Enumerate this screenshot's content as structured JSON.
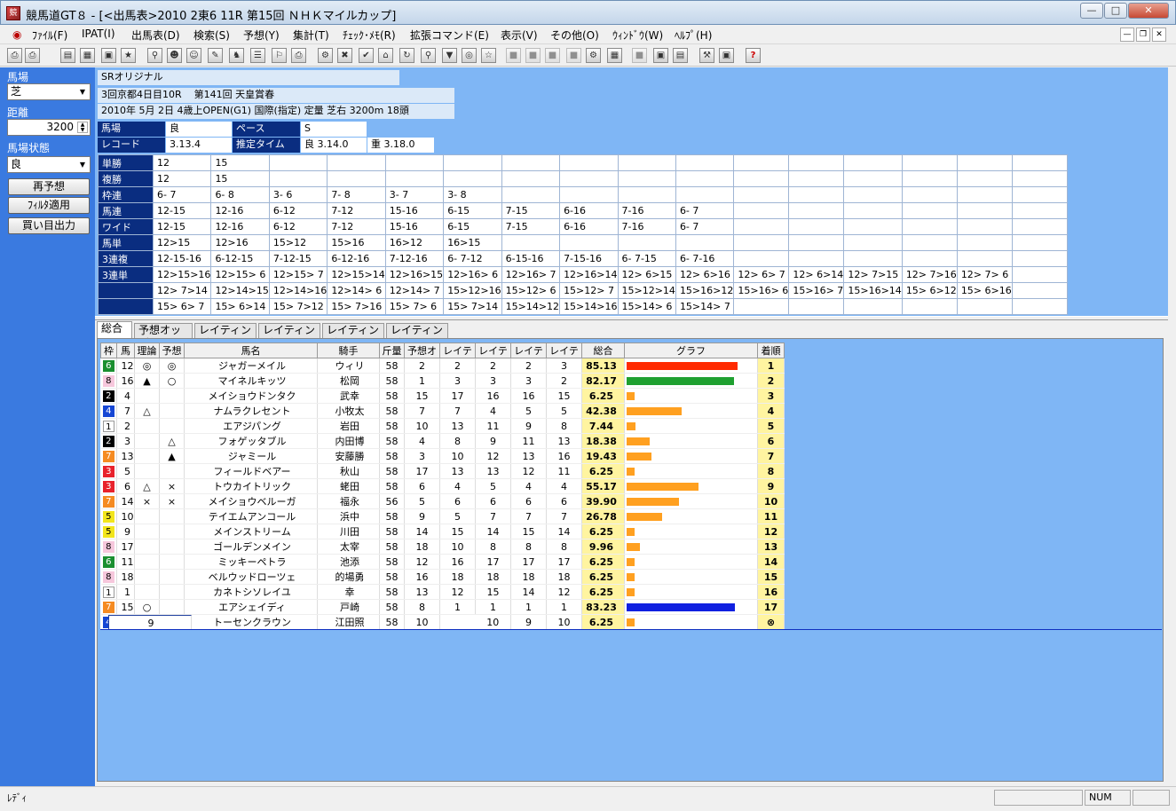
{
  "window": {
    "title": "競馬道GT８ - [<出馬表>2010 2東6 11R 第15回 ＮＨＫマイルカップ]",
    "app_icon": "競"
  },
  "menu": [
    "ﾌｧｲﾙ(F)",
    "IPAT(I)",
    "出馬表(D)",
    "検索(S)",
    "予想(Y)",
    "集計(T)",
    "ﾁｪｯｸ･ﾒﾓ(R)",
    "拡張コマンド(E)",
    "表示(V)",
    "その他(O)",
    "ｳｨﾝﾄﾞｳ(W)",
    "ﾍﾙﾌﾟ(H)"
  ],
  "left": {
    "baba_label": "馬場",
    "baba_value": "芝",
    "distance_label": "距離",
    "distance_value": "3200",
    "condition_label": "馬場状態",
    "condition_value": "良",
    "btn_repredict": "再予想",
    "btn_filter": "ﾌｨﾙﾀ適用",
    "btn_output": "買い目出力"
  },
  "info": {
    "source": "SRオリジナル",
    "meet": "3回京都4日目10R",
    "race_name": "第141回 天皇賞春",
    "detail": "2010年 5月 2日 4歳上OPEN(G1) 国際(指定) 定量 芝右 3200m 18頭",
    "baba_l": "馬場",
    "baba_v": "良",
    "pace_l": "ペース",
    "pace_v": "S",
    "record_l": "レコード",
    "record_v": "3.13.4",
    "est_l": "推定タイム",
    "est_good": "良 3.14.0",
    "est_heavy": "重 3.18.0"
  },
  "odds": [
    {
      "label": "単勝",
      "vals": [
        "12",
        "15",
        "",
        "",
        "",
        "",
        "",
        "",
        "",
        "",
        "",
        "",
        "",
        "",
        "",
        ""
      ]
    },
    {
      "label": "複勝",
      "vals": [
        "12",
        "15",
        "",
        "",
        "",
        "",
        "",
        "",
        "",
        "",
        "",
        "",
        "",
        "",
        "",
        ""
      ]
    },
    {
      "label": "枠連",
      "vals": [
        " 6- 7",
        " 6- 8",
        " 3- 6",
        " 7- 8",
        " 3- 7",
        " 3- 8",
        "",
        "",
        "",
        "",
        "",
        "",
        "",
        "",
        "",
        ""
      ]
    },
    {
      "label": "馬連",
      "vals": [
        "12-15",
        "12-16",
        "6-12",
        "7-12",
        "15-16",
        "6-15",
        "7-15",
        "6-16",
        "7-16",
        "6- 7",
        "",
        "",
        "",
        "",
        "",
        ""
      ]
    },
    {
      "label": "ワイド",
      "vals": [
        "12-15",
        "12-16",
        "6-12",
        "7-12",
        "15-16",
        "6-15",
        "7-15",
        "6-16",
        "7-16",
        "6- 7",
        "",
        "",
        "",
        "",
        "",
        ""
      ]
    },
    {
      "label": "馬単",
      "vals": [
        "12>15",
        "12>16",
        "15>12",
        "15>16",
        "16>12",
        "16>15",
        "",
        "",
        "",
        "",
        "",
        "",
        "",
        "",
        "",
        ""
      ]
    },
    {
      "label": "3連複",
      "vals": [
        "12-15-16",
        "6-12-15",
        "7-12-15",
        "6-12-16",
        "7-12-16",
        "6- 7-12",
        "6-15-16",
        "7-15-16",
        "6- 7-15",
        "6- 7-16",
        "",
        "",
        "",
        "",
        "",
        ""
      ]
    },
    {
      "label": "3連単",
      "vals": [
        "12>15>16",
        "12>15> 6",
        "12>15> 7",
        "12>15>14",
        "12>16>15",
        "12>16> 6",
        "12>16> 7",
        "12>16>14",
        "12> 6>15",
        "12> 6>16",
        "12> 6> 7",
        "12> 6>14",
        "12> 7>15",
        "12> 7>16",
        "12> 7> 6",
        ""
      ]
    },
    {
      "label": "",
      "vals": [
        "12> 7>14",
        "12>14>15",
        "12>14>16",
        "12>14> 6",
        "12>14> 7",
        "15>12>16",
        "15>12> 6",
        "15>12> 7",
        "15>12>14",
        "15>16>12",
        "15>16> 6",
        "15>16> 7",
        "15>16>14",
        "15> 6>12",
        "15> 6>16",
        ""
      ]
    },
    {
      "label": "",
      "vals": [
        "15> 6> 7",
        "15> 6>14",
        "15> 7>12",
        "15> 7>16",
        "15> 7> 6",
        "15> 7>14",
        "15>14>12",
        "15>14>16",
        "15>14> 6",
        "15>14> 7",
        "",
        "",
        "",
        "",
        "",
        ""
      ]
    }
  ],
  "tabs": [
    "総合",
    "予想オッズ",
    "レイティング",
    "レイティング",
    "レイティング",
    "レイティング"
  ],
  "columns": [
    "枠",
    "馬",
    "理論",
    "予想",
    "馬名",
    "騎手",
    "斤量",
    "予想オ",
    "レイテ",
    "レイテ",
    "レイテ",
    "レイテ",
    "総合",
    "グラフ",
    "着順"
  ],
  "bar_colors": {
    "red": "#ff2a00",
    "green": "#1fa030",
    "orange": "#ffa020",
    "blue": "#1020e0"
  },
  "waku_colors": {
    "1": [
      "#ffffff",
      "#000"
    ],
    "2": [
      "#000000",
      "#fff"
    ],
    "3": [
      "#e8222c",
      "#fff"
    ],
    "4": [
      "#1546d4",
      "#fff"
    ],
    "5": [
      "#f2e51c",
      "#000"
    ],
    "6": [
      "#1a8f30",
      "#fff"
    ],
    "7": [
      "#f58b22",
      "#fff"
    ],
    "8": [
      "#f6c7dc",
      "#000"
    ]
  },
  "horses": [
    {
      "waku": "6",
      "no": "12",
      "riron": "◎",
      "yoso": "◎",
      "name": "ジャガーメイル",
      "jockey": "ウィリ",
      "kin": "58",
      "yo": "2",
      "r1": "2",
      "r2": "2",
      "r3": "2",
      "r4": "3",
      "total": "85.13",
      "score": 0.85,
      "bar": "red",
      "rank": "1"
    },
    {
      "waku": "8",
      "no": "16",
      "riron": "▲",
      "yoso": "○",
      "name": "マイネルキッツ",
      "jockey": "松岡",
      "kin": "58",
      "yo": "1",
      "r1": "3",
      "r2": "3",
      "r3": "3",
      "r4": "2",
      "total": "82.17",
      "score": 0.82,
      "bar": "green",
      "rank": "2"
    },
    {
      "waku": "2",
      "no": "4",
      "riron": "",
      "yoso": "",
      "name": "メイショウドンタク",
      "jockey": "武幸",
      "kin": "58",
      "yo": "15",
      "r1": "17",
      "r2": "16",
      "r3": "16",
      "r4": "15",
      "total": "6.25",
      "score": 0.06,
      "bar": "orange",
      "rank": "3"
    },
    {
      "waku": "4",
      "no": "7",
      "riron": "△",
      "yoso": "",
      "name": "ナムラクレセント",
      "jockey": "小牧太",
      "kin": "58",
      "yo": "7",
      "r1": "7",
      "r2": "4",
      "r3": "5",
      "r4": "5",
      "total": "42.38",
      "score": 0.42,
      "bar": "orange",
      "rank": "4"
    },
    {
      "waku": "1",
      "no": "2",
      "riron": "",
      "yoso": "",
      "name": "エアジパング",
      "jockey": "岩田",
      "kin": "58",
      "yo": "10",
      "r1": "13",
      "r2": "11",
      "r3": "9",
      "r4": "8",
      "total": "7.44",
      "score": 0.07,
      "bar": "orange",
      "rank": "5"
    },
    {
      "waku": "2",
      "no": "3",
      "riron": "",
      "yoso": "△",
      "name": "フォゲッタブル",
      "jockey": "内田博",
      "kin": "58",
      "yo": "4",
      "r1": "8",
      "r2": "9",
      "r3": "11",
      "r4": "13",
      "total": "18.38",
      "score": 0.18,
      "bar": "orange",
      "rank": "6"
    },
    {
      "waku": "7",
      "no": "13",
      "riron": "",
      "yoso": "▲",
      "name": "ジャミール",
      "jockey": "安藤勝",
      "kin": "58",
      "yo": "3",
      "r1": "10",
      "r2": "12",
      "r3": "13",
      "r4": "16",
      "total": "19.43",
      "score": 0.19,
      "bar": "orange",
      "rank": "7"
    },
    {
      "waku": "3",
      "no": "5",
      "riron": "",
      "yoso": "",
      "name": "フィールドベアー",
      "jockey": "秋山",
      "kin": "58",
      "yo": "17",
      "r1": "13",
      "r2": "13",
      "r3": "12",
      "r4": "11",
      "total": "6.25",
      "score": 0.06,
      "bar": "orange",
      "rank": "8"
    },
    {
      "waku": "3",
      "no": "6",
      "riron": "△",
      "yoso": "×",
      "name": "トウカイトリック",
      "jockey": "蛯田",
      "kin": "58",
      "yo": "6",
      "r1": "4",
      "r2": "5",
      "r3": "4",
      "r4": "4",
      "total": "55.17",
      "score": 0.55,
      "bar": "orange",
      "rank": "9"
    },
    {
      "waku": "7",
      "no": "14",
      "riron": "×",
      "yoso": "×",
      "name": "メイショウベルーガ",
      "jockey": "福永",
      "kin": "56",
      "yo": "5",
      "r1": "6",
      "r2": "6",
      "r3": "6",
      "r4": "6",
      "total": "39.90",
      "score": 0.4,
      "bar": "orange",
      "rank": "10"
    },
    {
      "waku": "5",
      "no": "10",
      "riron": "",
      "yoso": "",
      "name": "テイエムアンコール",
      "jockey": "浜中",
      "kin": "58",
      "yo": "9",
      "r1": "5",
      "r2": "7",
      "r3": "7",
      "r4": "7",
      "total": "26.78",
      "score": 0.27,
      "bar": "orange",
      "rank": "11"
    },
    {
      "waku": "5",
      "no": "9",
      "riron": "",
      "yoso": "",
      "name": "メインストリーム",
      "jockey": "川田",
      "kin": "58",
      "yo": "14",
      "r1": "15",
      "r2": "14",
      "r3": "15",
      "r4": "14",
      "total": "6.25",
      "score": 0.06,
      "bar": "orange",
      "rank": "12"
    },
    {
      "waku": "8",
      "no": "17",
      "riron": "",
      "yoso": "",
      "name": "ゴールデンメイン",
      "jockey": "太宰",
      "kin": "58",
      "yo": "18",
      "r1": "10",
      "r2": "8",
      "r3": "8",
      "r4": "8",
      "total": "9.96",
      "score": 0.1,
      "bar": "orange",
      "rank": "13"
    },
    {
      "waku": "6",
      "no": "11",
      "riron": "",
      "yoso": "",
      "name": "ミッキーペトラ",
      "jockey": "池添",
      "kin": "58",
      "yo": "12",
      "r1": "16",
      "r2": "17",
      "r3": "17",
      "r4": "17",
      "total": "6.25",
      "score": 0.06,
      "bar": "orange",
      "rank": "14"
    },
    {
      "waku": "8",
      "no": "18",
      "riron": "",
      "yoso": "",
      "name": "ベルウッドローツェ",
      "jockey": "的場勇",
      "kin": "58",
      "yo": "16",
      "r1": "18",
      "r2": "18",
      "r3": "18",
      "r4": "18",
      "total": "6.25",
      "score": 0.06,
      "bar": "orange",
      "rank": "15"
    },
    {
      "waku": "1",
      "no": "1",
      "riron": "",
      "yoso": "",
      "name": "カネトシソレイユ",
      "jockey": "幸",
      "kin": "58",
      "yo": "13",
      "r1": "12",
      "r2": "15",
      "r3": "14",
      "r4": "12",
      "total": "6.25",
      "score": 0.06,
      "bar": "orange",
      "rank": "16"
    },
    {
      "waku": "7",
      "no": "15",
      "riron": "○",
      "yoso": "",
      "name": "エアシェイディ",
      "jockey": "戸崎",
      "kin": "58",
      "yo": "8",
      "r1": "1",
      "r2": "1",
      "r3": "1",
      "r4": "1",
      "total": "83.23",
      "score": 0.83,
      "bar": "blue",
      "rank": "17"
    },
    {
      "waku": "4",
      "no": "8",
      "riron": "",
      "yoso": "",
      "name": "トーセンクラウン",
      "jockey": "江田照",
      "kin": "58",
      "yo": "10",
      "r1": "9",
      "r2": "10",
      "r3": "9",
      "r4": "10",
      "total": "6.25",
      "score": 0.06,
      "bar": "orange",
      "rank": "⊗"
    }
  ],
  "status": {
    "text": "ﾚﾃﾞｨ",
    "num": "NUM"
  }
}
